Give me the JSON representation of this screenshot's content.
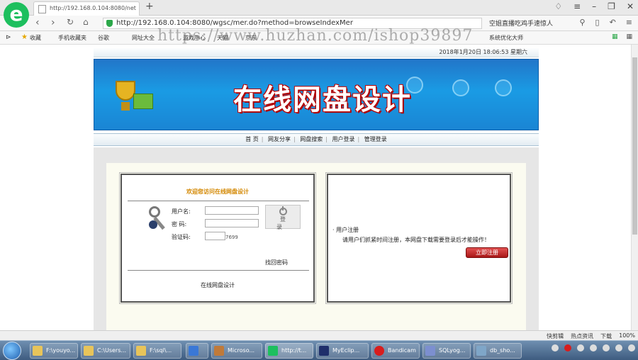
{
  "browser": {
    "tab_title": "http://192.168.0.104:8080/net",
    "address": "http://192.168.0.104:8080/wgsc/mer.do?method=browseIndexMer",
    "address_right": "空姐直播吃鸡手速惊人",
    "bookmarks": [
      "收藏",
      "手机收藏夹",
      "谷歌",
      "网址大全",
      "游戏中心",
      "天猫",
      "京东",
      "系统优化大师"
    ],
    "watermark": "https://www.huzhan.com/ishop39897"
  },
  "page": {
    "datetime": "2018年1月20日 18:06:53 星期六",
    "banner_title": "在线网盘设计",
    "menu": [
      "首 页",
      "网友分享",
      "网盘搜索",
      "用户登录",
      "管理登录"
    ],
    "login": {
      "welcome": "欢迎您访问在线网盘设计",
      "username_label": "用户名:",
      "password_label": "密  码:",
      "captcha_label": "验证码:",
      "captcha_value": "7699",
      "login_button": "登 录",
      "forgot": "找回密码",
      "site_name": "在线网盘设计"
    },
    "register": {
      "title": "· 用户注册",
      "desc": "请用户们抓紧时间注册，本网盘下载需要登录后才能操作！",
      "button": "立即注册"
    }
  },
  "statusbar": {
    "items": [
      "快剪辑",
      "热点资讯",
      "下载",
      "100%"
    ]
  },
  "taskbar": {
    "items": [
      "F:\\youyo...",
      "C:\\Users...",
      "F:\\sql\\...",
      "",
      "Microso...",
      "http://t...",
      "MyEclip...",
      "Bandicam",
      "SQLyog...",
      "db_sho..."
    ]
  }
}
